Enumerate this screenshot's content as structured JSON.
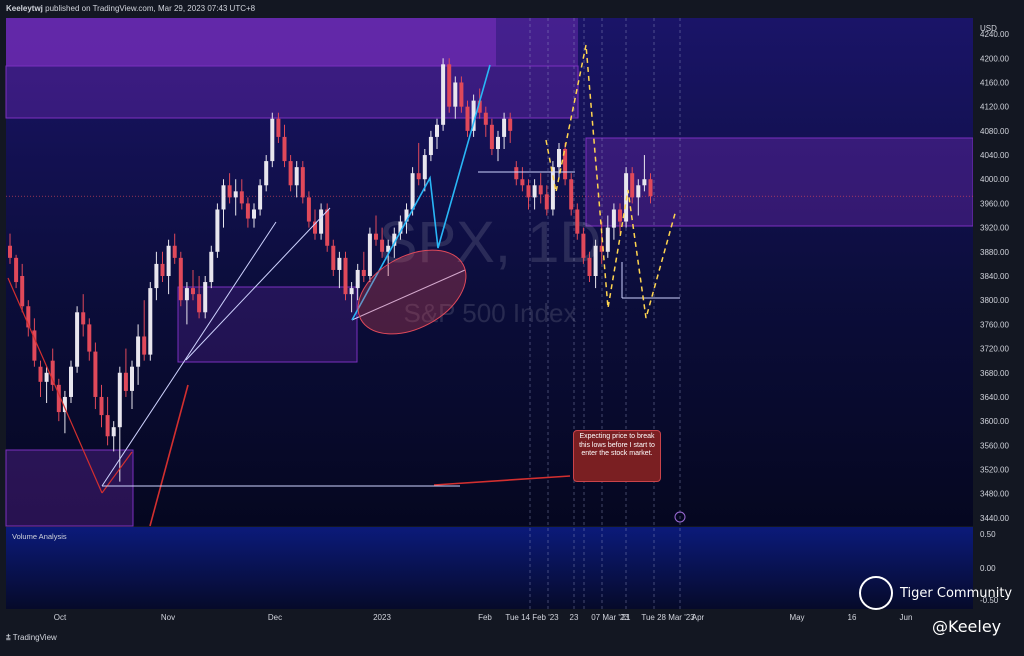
{
  "header": {
    "author": "Keeleytwj",
    "published_text": "published on TradingView.com, Mar 29, 2023 07:43 UTC+8"
  },
  "branding": {
    "tradingview": "TradingView",
    "tiger": "Tiger Community",
    "handle": "@Keeley"
  },
  "watermark": {
    "symbol": "SPX, 1D",
    "name": "S&P 500 Index"
  },
  "annotation": {
    "note": "Expecting price to break this lows before I start to enter the stock market."
  },
  "volume_panel": {
    "title": "Volume Analysis",
    "ticks": [
      "0.50",
      "0.00",
      "-0.50"
    ]
  },
  "colors": {
    "background": "#0a0c3a",
    "up": "#e8e6ee",
    "down": "#e0495a",
    "zone": "#7b2fbf",
    "arrow_blue": "#29b6f6",
    "arrow_white": "#cfd3ff",
    "arrow_red": "#d32f2f",
    "dashed_yellow": "#ffd54f"
  },
  "chart_data": {
    "type": "candlestick",
    "currency": "USD",
    "ylim": [
      3420,
      4260
    ],
    "y_ticks": [
      4240,
      4200,
      4160,
      4120,
      4080,
      4040,
      4000,
      3960,
      3920,
      3880,
      3840,
      3800,
      3760,
      3720,
      3680,
      3640,
      3600,
      3560,
      3520,
      3480,
      3440
    ],
    "x_labels": [
      "Oct",
      "Nov",
      "Dec",
      "2023",
      "Feb",
      "Tue 14 Feb '23",
      "23",
      "07 Mar '23",
      "21",
      "Tue 28 Mar '23",
      "Apr",
      "May",
      "16",
      "Jun"
    ],
    "last_price": 3972,
    "candles": [
      {
        "o": 3890,
        "h": 3910,
        "l": 3860,
        "c": 3870
      },
      {
        "o": 3870,
        "h": 3875,
        "l": 3820,
        "c": 3830
      },
      {
        "o": 3840,
        "h": 3860,
        "l": 3780,
        "c": 3790
      },
      {
        "o": 3790,
        "h": 3800,
        "l": 3740,
        "c": 3755
      },
      {
        "o": 3750,
        "h": 3770,
        "l": 3690,
        "c": 3700
      },
      {
        "o": 3690,
        "h": 3700,
        "l": 3640,
        "c": 3665
      },
      {
        "o": 3665,
        "h": 3690,
        "l": 3630,
        "c": 3680
      },
      {
        "o": 3700,
        "h": 3720,
        "l": 3650,
        "c": 3660
      },
      {
        "o": 3660,
        "h": 3670,
        "l": 3600,
        "c": 3615
      },
      {
        "o": 3615,
        "h": 3650,
        "l": 3580,
        "c": 3640
      },
      {
        "o": 3640,
        "h": 3700,
        "l": 3630,
        "c": 3690
      },
      {
        "o": 3690,
        "h": 3790,
        "l": 3680,
        "c": 3780
      },
      {
        "o": 3780,
        "h": 3810,
        "l": 3740,
        "c": 3760
      },
      {
        "o": 3760,
        "h": 3770,
        "l": 3700,
        "c": 3715
      },
      {
        "o": 3715,
        "h": 3730,
        "l": 3620,
        "c": 3640
      },
      {
        "o": 3640,
        "h": 3660,
        "l": 3590,
        "c": 3610
      },
      {
        "o": 3610,
        "h": 3640,
        "l": 3560,
        "c": 3575
      },
      {
        "o": 3575,
        "h": 3600,
        "l": 3550,
        "c": 3590
      },
      {
        "o": 3590,
        "h": 3690,
        "l": 3500,
        "c": 3680
      },
      {
        "o": 3680,
        "h": 3720,
        "l": 3640,
        "c": 3650
      },
      {
        "o": 3650,
        "h": 3700,
        "l": 3620,
        "c": 3690
      },
      {
        "o": 3690,
        "h": 3760,
        "l": 3660,
        "c": 3740
      },
      {
        "o": 3740,
        "h": 3800,
        "l": 3700,
        "c": 3710
      },
      {
        "o": 3710,
        "h": 3830,
        "l": 3700,
        "c": 3820
      },
      {
        "o": 3820,
        "h": 3880,
        "l": 3800,
        "c": 3860
      },
      {
        "o": 3860,
        "h": 3880,
        "l": 3830,
        "c": 3840
      },
      {
        "o": 3840,
        "h": 3900,
        "l": 3810,
        "c": 3890
      },
      {
        "o": 3890,
        "h": 3910,
        "l": 3860,
        "c": 3870
      },
      {
        "o": 3870,
        "h": 3880,
        "l": 3790,
        "c": 3800
      },
      {
        "o": 3800,
        "h": 3830,
        "l": 3760,
        "c": 3820
      },
      {
        "o": 3820,
        "h": 3850,
        "l": 3800,
        "c": 3810
      },
      {
        "o": 3810,
        "h": 3840,
        "l": 3770,
        "c": 3780
      },
      {
        "o": 3780,
        "h": 3840,
        "l": 3770,
        "c": 3830
      },
      {
        "o": 3830,
        "h": 3890,
        "l": 3820,
        "c": 3880
      },
      {
        "o": 3880,
        "h": 3960,
        "l": 3870,
        "c": 3950
      },
      {
        "o": 3950,
        "h": 4000,
        "l": 3920,
        "c": 3990
      },
      {
        "o": 3990,
        "h": 4010,
        "l": 3960,
        "c": 3970
      },
      {
        "o": 3970,
        "h": 4000,
        "l": 3940,
        "c": 3980
      },
      {
        "o": 3980,
        "h": 4000,
        "l": 3950,
        "c": 3960
      },
      {
        "o": 3960,
        "h": 3970,
        "l": 3920,
        "c": 3935
      },
      {
        "o": 3935,
        "h": 3960,
        "l": 3920,
        "c": 3950
      },
      {
        "o": 3950,
        "h": 4000,
        "l": 3940,
        "c": 3990
      },
      {
        "o": 3990,
        "h": 4040,
        "l": 3980,
        "c": 4030
      },
      {
        "o": 4030,
        "h": 4110,
        "l": 4020,
        "c": 4100
      },
      {
        "o": 4100,
        "h": 4110,
        "l": 4060,
        "c": 4070
      },
      {
        "o": 4070,
        "h": 4090,
        "l": 4020,
        "c": 4030
      },
      {
        "o": 4030,
        "h": 4040,
        "l": 3980,
        "c": 3990
      },
      {
        "o": 3990,
        "h": 4030,
        "l": 3970,
        "c": 4020
      },
      {
        "o": 4020,
        "h": 4030,
        "l": 3960,
        "c": 3970
      },
      {
        "o": 3970,
        "h": 3980,
        "l": 3920,
        "c": 3930
      },
      {
        "o": 3930,
        "h": 3950,
        "l": 3900,
        "c": 3910
      },
      {
        "o": 3910,
        "h": 3960,
        "l": 3900,
        "c": 3950
      },
      {
        "o": 3950,
        "h": 3960,
        "l": 3880,
        "c": 3890
      },
      {
        "o": 3890,
        "h": 3900,
        "l": 3840,
        "c": 3850
      },
      {
        "o": 3850,
        "h": 3880,
        "l": 3820,
        "c": 3870
      },
      {
        "o": 3870,
        "h": 3880,
        "l": 3800,
        "c": 3810
      },
      {
        "o": 3810,
        "h": 3830,
        "l": 3780,
        "c": 3820
      },
      {
        "o": 3820,
        "h": 3860,
        "l": 3800,
        "c": 3850
      },
      {
        "o": 3850,
        "h": 3880,
        "l": 3830,
        "c": 3840
      },
      {
        "o": 3840,
        "h": 3920,
        "l": 3830,
        "c": 3910
      },
      {
        "o": 3910,
        "h": 3940,
        "l": 3890,
        "c": 3900
      },
      {
        "o": 3900,
        "h": 3920,
        "l": 3870,
        "c": 3880
      },
      {
        "o": 3880,
        "h": 3900,
        "l": 3840,
        "c": 3890
      },
      {
        "o": 3890,
        "h": 3920,
        "l": 3870,
        "c": 3910
      },
      {
        "o": 3910,
        "h": 3940,
        "l": 3900,
        "c": 3930
      },
      {
        "o": 3930,
        "h": 3960,
        "l": 3910,
        "c": 3950
      },
      {
        "o": 3950,
        "h": 4020,
        "l": 3940,
        "c": 4010
      },
      {
        "o": 4010,
        "h": 4060,
        "l": 3990,
        "c": 4000
      },
      {
        "o": 4000,
        "h": 4050,
        "l": 3980,
        "c": 4040
      },
      {
        "o": 4040,
        "h": 4080,
        "l": 4030,
        "c": 4070
      },
      {
        "o": 4070,
        "h": 4100,
        "l": 4050,
        "c": 4090
      },
      {
        "o": 4090,
        "h": 4200,
        "l": 4080,
        "c": 4190
      },
      {
        "o": 4190,
        "h": 4200,
        "l": 4110,
        "c": 4120
      },
      {
        "o": 4120,
        "h": 4170,
        "l": 4100,
        "c": 4160
      },
      {
        "o": 4160,
        "h": 4170,
        "l": 4110,
        "c": 4120
      },
      {
        "o": 4120,
        "h": 4130,
        "l": 4070,
        "c": 4080
      },
      {
        "o": 4080,
        "h": 4140,
        "l": 4070,
        "c": 4130
      },
      {
        "o": 4130,
        "h": 4150,
        "l": 4100,
        "c": 4110
      },
      {
        "o": 4110,
        "h": 4120,
        "l": 4070,
        "c": 4090
      },
      {
        "o": 4090,
        "h": 4100,
        "l": 4040,
        "c": 4050
      },
      {
        "o": 4050,
        "h": 4080,
        "l": 4030,
        "c": 4070
      },
      {
        "o": 4070,
        "h": 4110,
        "l": 4050,
        "c": 4100
      },
      {
        "o": 4100,
        "h": 4110,
        "l": 4060,
        "c": 4080
      },
      {
        "o": 4020,
        "h": 4030,
        "l": 3990,
        "c": 4000
      },
      {
        "o": 4000,
        "h": 4020,
        "l": 3980,
        "c": 3990
      },
      {
        "o": 3990,
        "h": 4000,
        "l": 3950,
        "c": 3970
      },
      {
        "o": 3970,
        "h": 4000,
        "l": 3950,
        "c": 3990
      },
      {
        "o": 3990,
        "h": 4010,
        "l": 3960,
        "c": 3975
      },
      {
        "o": 3975,
        "h": 3990,
        "l": 3940,
        "c": 3950
      },
      {
        "o": 3950,
        "h": 4030,
        "l": 3940,
        "c": 4020
      },
      {
        "o": 4020,
        "h": 4060,
        "l": 4000,
        "c": 4050
      },
      {
        "o": 4050,
        "h": 4060,
        "l": 3990,
        "c": 4000
      },
      {
        "o": 4000,
        "h": 4010,
        "l": 3940,
        "c": 3950
      },
      {
        "o": 3950,
        "h": 3960,
        "l": 3900,
        "c": 3910
      },
      {
        "o": 3910,
        "h": 3920,
        "l": 3860,
        "c": 3870
      },
      {
        "o": 3870,
        "h": 3880,
        "l": 3830,
        "c": 3840
      },
      {
        "o": 3840,
        "h": 3900,
        "l": 3820,
        "c": 3890
      },
      {
        "o": 3890,
        "h": 3930,
        "l": 3860,
        "c": 3880
      },
      {
        "o": 3880,
        "h": 3940,
        "l": 3870,
        "c": 3920
      },
      {
        "o": 3920,
        "h": 3960,
        "l": 3900,
        "c": 3950
      },
      {
        "o": 3950,
        "h": 3960,
        "l": 3910,
        "c": 3930
      },
      {
        "o": 3930,
        "h": 4020,
        "l": 3920,
        "c": 4010
      },
      {
        "o": 4010,
        "h": 4020,
        "l": 3960,
        "c": 3970
      },
      {
        "o": 3970,
        "h": 4000,
        "l": 3940,
        "c": 3990
      },
      {
        "o": 3990,
        "h": 4040,
        "l": 3980,
        "c": 4000
      },
      {
        "o": 4000,
        "h": 4010,
        "l": 3960,
        "c": 3972
      }
    ]
  }
}
